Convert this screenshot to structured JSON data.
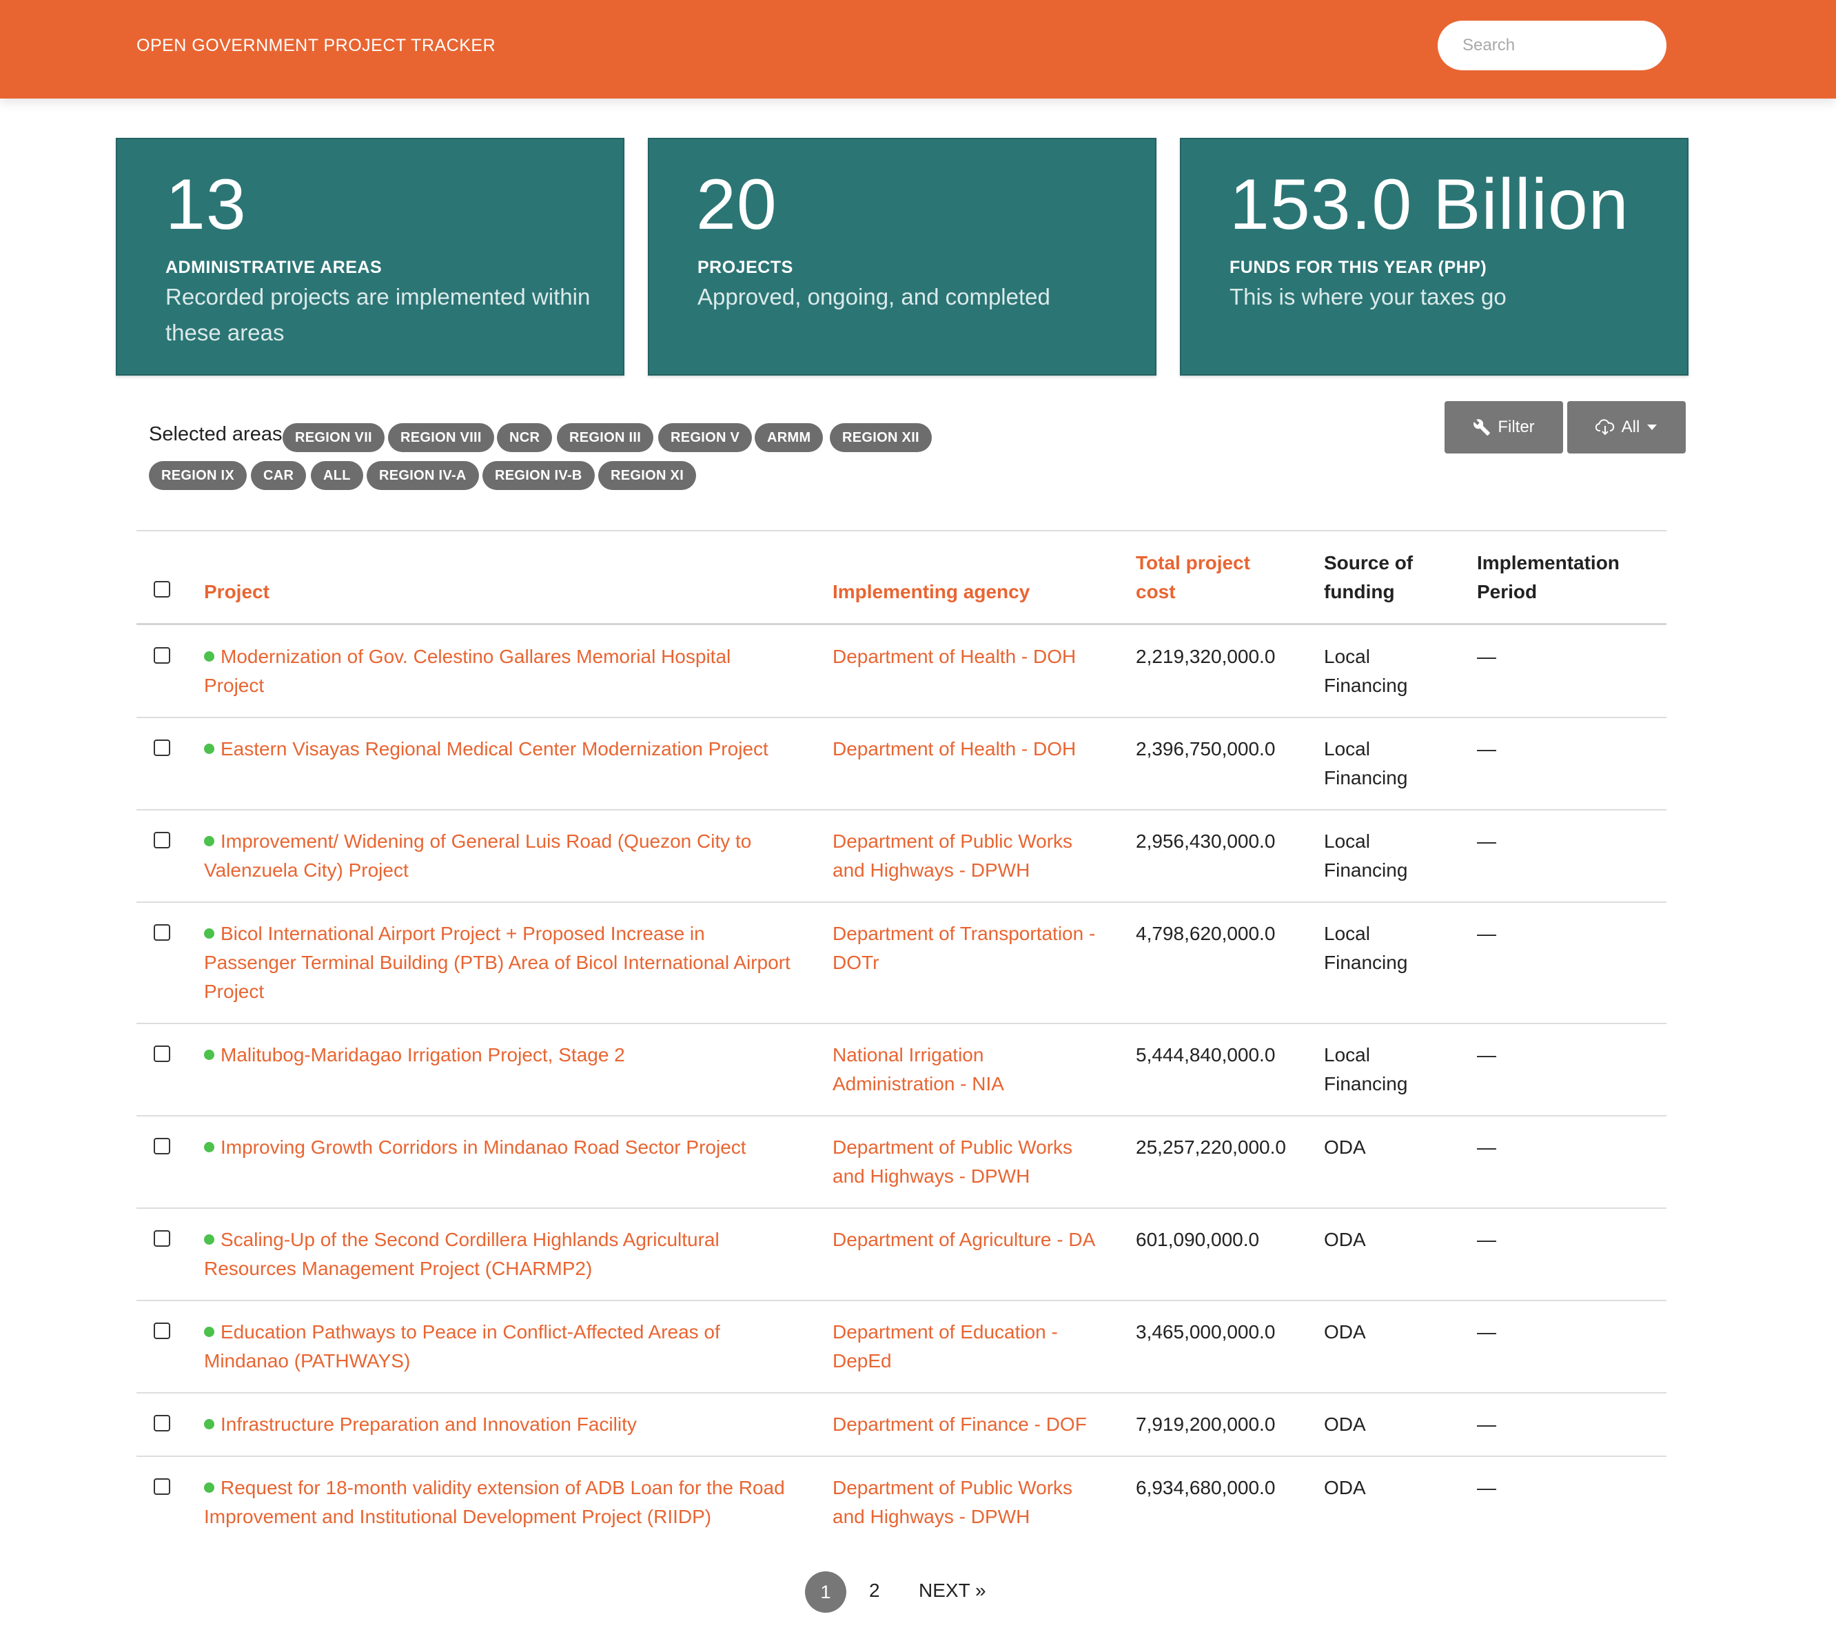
{
  "header": {
    "brand": "OPEN GOVERNMENT PROJECT TRACKER",
    "search_placeholder": "Search"
  },
  "stats": [
    {
      "number": "13",
      "label": "ADMINISTRATIVE AREAS",
      "desc": "Recorded projects are implemented within these areas"
    },
    {
      "number": "20",
      "label": "PROJECTS",
      "desc": "Approved, ongoing, and completed"
    },
    {
      "number": "153.0 Billion",
      "label": "FUNDS FOR THIS YEAR (PHP)",
      "desc": "This is where your taxes go"
    }
  ],
  "areas": {
    "label": "Selected areas",
    "chips": [
      "REGION VII",
      "REGION VIII",
      "NCR",
      "REGION III",
      "REGION V",
      "ARMM",
      "REGION XII",
      "REGION IX",
      "CAR",
      "ALL",
      "REGION IV-A",
      "REGION IV-B",
      "REGION XI"
    ]
  },
  "toolbar": {
    "filter_label": "Filter",
    "all_label": "All",
    "wrench_icon": "wrench-icon",
    "cloud_icon": "cloud-download-icon",
    "caret_icon": "caret-down-icon"
  },
  "table": {
    "headers": {
      "project": "Project",
      "agency": "Implementing agency",
      "cost_line1": "Total project",
      "cost_line2": "cost",
      "source_line1": "Source of",
      "source_line2": "funding",
      "period_line1": "Implementation",
      "period_line2": "Period"
    },
    "rows": [
      {
        "project": [
          "Modernization of Gov. Celestino Gallares Memorial Hospital",
          "Project"
        ],
        "agency": [
          "Department of Health - DOH"
        ],
        "cost": "2,219,320,000.0",
        "source": [
          "Local",
          "Financing"
        ],
        "period": "—"
      },
      {
        "project": [
          "Eastern Visayas Regional Medical Center Modernization Project"
        ],
        "agency": [
          "Department of Health - DOH"
        ],
        "cost": "2,396,750,000.0",
        "source": [
          "Local",
          "Financing"
        ],
        "period": "—"
      },
      {
        "project": [
          "Improvement/ Widening of General Luis Road (Quezon City to",
          "Valenzuela City) Project"
        ],
        "agency": [
          "Department of Public Works",
          "and Highways - DPWH"
        ],
        "cost": "2,956,430,000.0",
        "source": [
          "Local",
          "Financing"
        ],
        "period": "—"
      },
      {
        "project": [
          "Bicol International Airport Project + Proposed Increase in",
          "Passenger Terminal Building (PTB) Area of Bicol International Airport",
          "Project"
        ],
        "agency": [
          "Department of Transportation -",
          "DOTr"
        ],
        "cost": "4,798,620,000.0",
        "source": [
          "Local",
          "Financing"
        ],
        "period": "—"
      },
      {
        "project": [
          "Malitubog-Maridagao Irrigation Project, Stage 2"
        ],
        "agency": [
          "National Irrigation",
          "Administration - NIA"
        ],
        "cost": "5,444,840,000.0",
        "source": [
          "Local",
          "Financing"
        ],
        "period": "—"
      },
      {
        "project": [
          "Improving Growth Corridors in Mindanao Road Sector Project"
        ],
        "agency": [
          "Department of Public Works",
          "and Highways - DPWH"
        ],
        "cost": "25,257,220,000.0",
        "source": [
          "ODA"
        ],
        "period": "—"
      },
      {
        "project": [
          "Scaling-Up of the Second Cordillera Highlands Agricultural",
          "Resources Management Project (CHARMP2)"
        ],
        "agency": [
          "Department of Agriculture - DA"
        ],
        "cost": "601,090,000.0",
        "source": [
          "ODA"
        ],
        "period": "—"
      },
      {
        "project": [
          "Education Pathways to Peace in Conflict-Affected Areas of",
          "Mindanao (PATHWAYS)"
        ],
        "agency": [
          "Department of Education -",
          "DepEd"
        ],
        "cost": "3,465,000,000.0",
        "source": [
          "ODA"
        ],
        "period": "—"
      },
      {
        "project": [
          "Infrastructure Preparation and Innovation Facility"
        ],
        "agency": [
          "Department of Finance - DOF"
        ],
        "cost": "7,919,200,000.0",
        "source": [
          "ODA"
        ],
        "period": "—"
      },
      {
        "project": [
          "Request for 18-month validity extension of ADB Loan for the Road",
          "Improvement and Institutional Development Project (RIIDP)"
        ],
        "agency": [
          "Department of Public Works",
          "and Highways - DPWH"
        ],
        "cost": "6,934,680,000.0",
        "source": [
          "ODA"
        ],
        "period": "—"
      }
    ]
  },
  "pagination": {
    "current": "1",
    "page2": "2",
    "next": "NEXT »"
  },
  "colors": {
    "accent": "#e86532",
    "card": "#2c7575",
    "chip": "#6d6d6d",
    "status_dot": "#4cc14c"
  }
}
